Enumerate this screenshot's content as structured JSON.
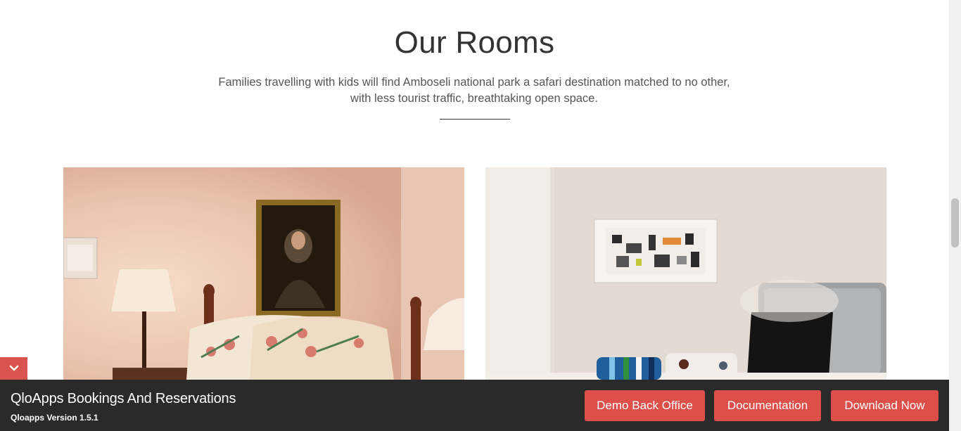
{
  "rooms_section": {
    "title": "Our Rooms",
    "description_line1": "Families travelling with kids will find Amboseli national park a safari destination matched to no other,",
    "description_line2": "with less tourist traffic, breathtaking open space."
  },
  "rooms": [
    {
      "image": "bedroom-with-lamp-and-portrait-photo"
    },
    {
      "image": "room-with-artwork-and-laptop-photo"
    }
  ],
  "footer_bar": {
    "title": "QloApps Bookings And Reservations",
    "version": "Qloapps Version 1.5.1",
    "toggle_icon": "chevron-down-icon",
    "buttons": {
      "demo_back_office": "Demo Back Office",
      "documentation": "Documentation",
      "download_now": "Download Now"
    },
    "accent_color": "#de4f4a",
    "bar_color": "#2a2a2a"
  }
}
